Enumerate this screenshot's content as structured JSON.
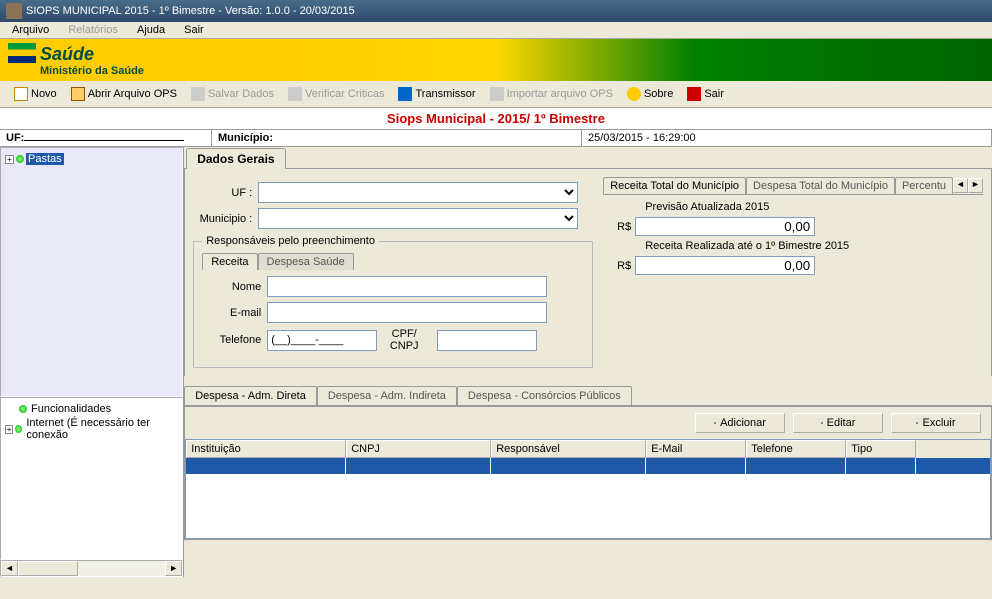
{
  "window": {
    "title": "SIOPS MUNICIPAL 2015 - 1º Bimestre - Versão: 1.0.0 - 20/03/2015"
  },
  "menu": {
    "arquivo": "Arquivo",
    "relatorios": "Relatórios",
    "ajuda": "Ajuda",
    "sair": "Sair"
  },
  "banner": {
    "logo": "Saúde",
    "sub": "Ministério da Saúde"
  },
  "toolbar": {
    "novo": "Novo",
    "abrir": "Abrir Arquivo OPS",
    "salvar": "Salvar Dados",
    "verificar": "Verificar Criticas",
    "transmissor": "Transmissor",
    "importar": "Importar arquivo OPS",
    "sobre": "Sobre",
    "sair": "Sair"
  },
  "subtitle": "Siops Municipal - 2015/ 1º Bimestre",
  "info": {
    "uf_label": "UF:",
    "uf_value": "",
    "mun_label": "Município:",
    "timestamp": "25/03/2015 - 16:29:00"
  },
  "tree": {
    "pastas": "Pastas",
    "funcionalidades": "Funcionalidades",
    "internet": "Internet (É necessário ter conexão"
  },
  "dados": {
    "tab": "Dados Gerais",
    "uf": "UF :",
    "municipio": "Municipio :",
    "fieldset": "Responsáveis pelo preenchimento",
    "tab_receita": "Receita",
    "tab_despesa": "Despesa Saúde",
    "nome": "Nome",
    "email": "E-mail",
    "telefone": "Telefone",
    "telefone_mask": "(__)____-____",
    "cpf": "CPF/ CNPJ"
  },
  "receita": {
    "tab1": "Receita Total do Município",
    "tab2": "Despesa Total do Município",
    "tab3": "Percentu",
    "previsao": "Previsão Atualizada 2015",
    "realizada": "Receita Realizada até o 1º Bimestre 2015",
    "currency": "R$",
    "val1": "0,00",
    "val2": "0,00"
  },
  "despesa_tabs": {
    "t1": "Despesa - Adm. Direta",
    "t2": "Despesa - Adm. Indireta",
    "t3": "Despesa - Consórcios Públicos"
  },
  "actions": {
    "adicionar": "Adicionar",
    "editar": "Editar",
    "excluir": "Excluir"
  },
  "grid": {
    "instituicao": "Instituição",
    "cnpj": "CNPJ",
    "responsavel": "Responsável",
    "email": "E-Mail",
    "telefone": "Telefone",
    "tipo": "Tipo"
  }
}
